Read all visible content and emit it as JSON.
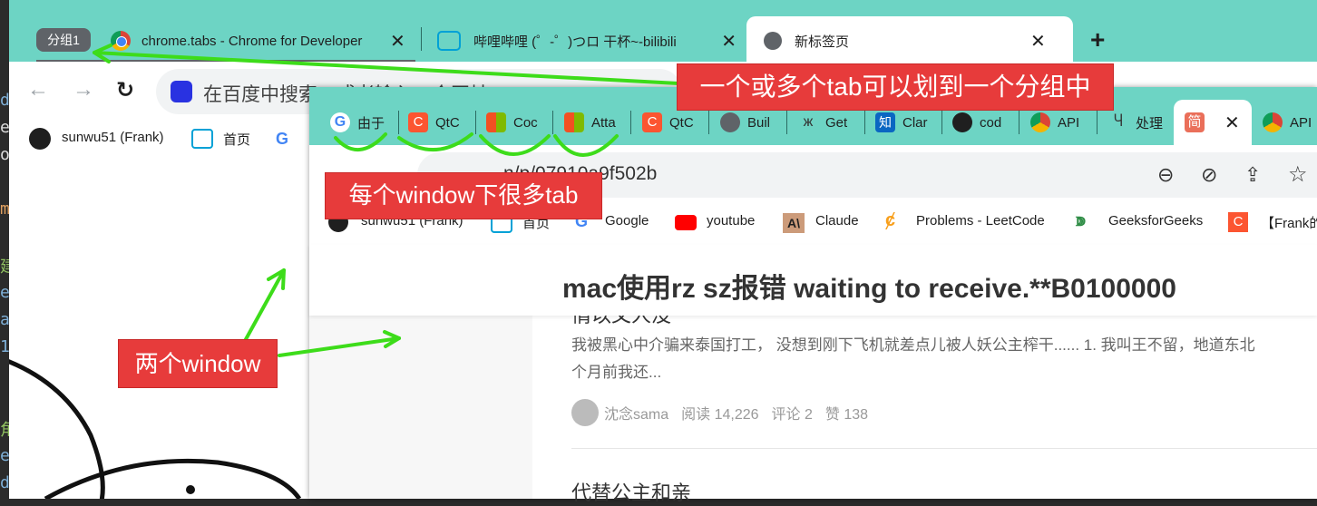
{
  "window1": {
    "group_chip": "分组1",
    "tabs": [
      {
        "title": "chrome.tabs - Chrome for Developer"
      },
      {
        "title": "哔哩哔哩 (゜-゜)つロ 干杯~-bilibili"
      },
      {
        "title": "新标签页",
        "active": true
      }
    ],
    "omnibox_placeholder": "在百度中搜索，或者输入一个网址",
    "bookmarks": [
      "sunwu51 (Frank)",
      "首页"
    ]
  },
  "window2": {
    "tabs": [
      {
        "title": "由于",
        "icon": "google-icon"
      },
      {
        "title": "QtC",
        "icon": "csdn-icon"
      },
      {
        "title": "Coc",
        "icon": "microsoft-icon"
      },
      {
        "title": "Atta",
        "icon": "microsoft-icon"
      },
      {
        "title": "QtC",
        "icon": "csdn-icon"
      },
      {
        "title": "Buil",
        "icon": "globe-icon"
      },
      {
        "title": "Get",
        "icon": "butterfly-icon"
      },
      {
        "title": "Clar",
        "icon": "zhihu-icon"
      },
      {
        "title": "cod",
        "icon": "github-icon"
      },
      {
        "title": "API",
        "icon": "chrome-icon"
      },
      {
        "title": "处理",
        "icon": "typora-icon"
      },
      {
        "title": "",
        "icon": "jianshu-icon",
        "active": true
      },
      {
        "title": "API",
        "icon": "chrome-icon"
      }
    ],
    "active_tab_icon_text": "简",
    "url": "jianshu.com/p/07910a9f502b",
    "url_visible": "n/p/07910a9f502b",
    "bookmarks": [
      "sunwu51 (Frank)",
      "首页",
      "Google",
      "youtube",
      "Claude",
      "Problems - LeetCode",
      "GeeksforGeeks",
      "【Frank的"
    ],
    "article_title": "mac使用rz sz报错 waiting to receive.**B0100000",
    "feed": {
      "item1_title_partial": "情以父人没",
      "item1_text": "我被黑心中介骗来泰国打工， 没想到刚下飞机就差点儿被人妖公主榨干...... 1. 我叫王不留，地道东北",
      "item1_text2": "个月前我还...",
      "author": "沈念sama",
      "reads": "阅读 14,226",
      "comments": "评论 2",
      "likes": "赞 138",
      "item2_title": "代替公主和亲"
    }
  },
  "annotations": {
    "group_label": "一个或多个tab可以划到一个分组中",
    "tabs_label": "每个window下很多tab",
    "windows_label": "两个window"
  },
  "colors": {
    "tabbar": "#6dd4c4",
    "annotation_red": "#e73b3b",
    "arrow_green": "#3ddc1a"
  }
}
